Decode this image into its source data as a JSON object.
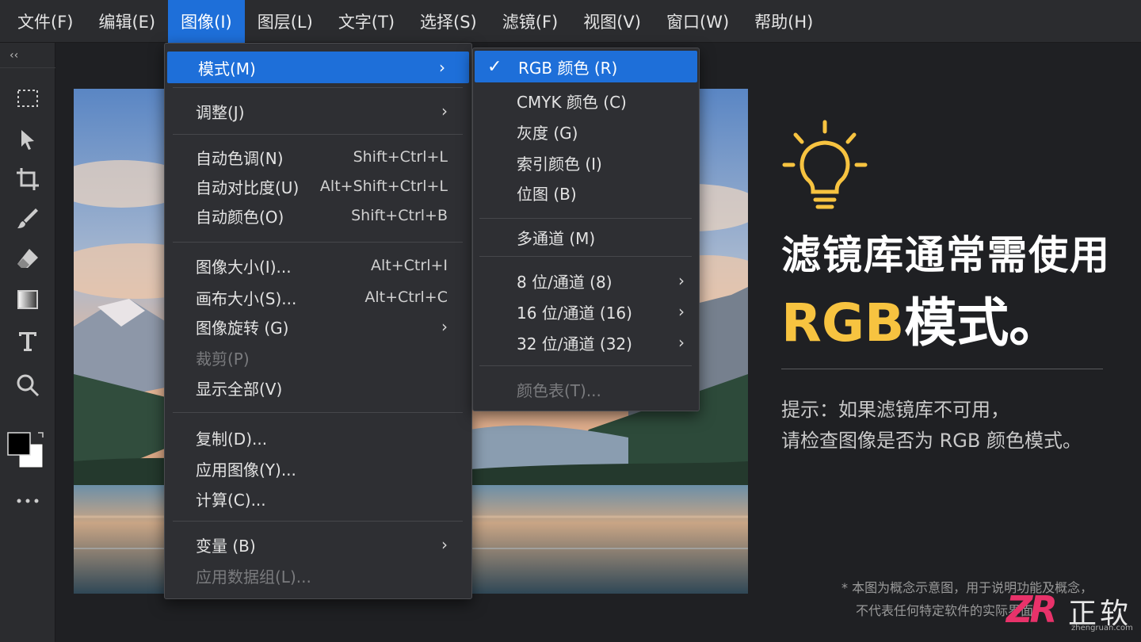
{
  "menubar": {
    "items": [
      "文件(F)",
      "编辑(E)",
      "图像(I)",
      "图层(L)",
      "文字(T)",
      "选择(S)",
      "滤镜(F)",
      "视图(V)",
      "窗口(W)",
      "帮助(H)"
    ],
    "active_index": 2
  },
  "toolbar": {
    "collapse": "‹‹",
    "tools": [
      "marquee-icon",
      "move-icon",
      "crop-icon",
      "brush-icon",
      "eraser-icon",
      "gradient-icon",
      "type-icon",
      "zoom-icon",
      "color-swatch-icon",
      "more-icon"
    ]
  },
  "image_menu": {
    "items": [
      {
        "label": "模式(M)",
        "shortcut": "",
        "submenu": true,
        "highlight": true
      },
      {
        "label": "调整(J)",
        "shortcut": "",
        "submenu": true
      },
      {
        "label": "自动色调(N)",
        "shortcut": "Shift+Ctrl+L"
      },
      {
        "label": "自动对比度(U)",
        "shortcut": "Alt+Shift+Ctrl+L"
      },
      {
        "label": "自动颜色(O)",
        "shortcut": "Shift+Ctrl+B"
      },
      {
        "label": "图像大小(I)...",
        "shortcut": "Alt+Ctrl+I"
      },
      {
        "label": "画布大小(S)...",
        "shortcut": "Alt+Ctrl+C"
      },
      {
        "label": "图像旋转 (G)",
        "shortcut": "",
        "submenu": true
      },
      {
        "label": "裁剪(P)",
        "shortcut": "",
        "disabled": true
      },
      {
        "label": "显示全部(V)",
        "shortcut": ""
      },
      {
        "label": "复制(D)...",
        "shortcut": ""
      },
      {
        "label": "应用图像(Y)...",
        "shortcut": ""
      },
      {
        "label": "计算(C)...",
        "shortcut": ""
      },
      {
        "label": "变量 (B)",
        "shortcut": "",
        "submenu": true
      },
      {
        "label": "应用数据组(L)...",
        "shortcut": "",
        "disabled": true
      }
    ]
  },
  "mode_menu": {
    "items": [
      {
        "label": "RGB 颜色 (R)",
        "checked": true,
        "highlight": true
      },
      {
        "label": "CMYK 颜色 (C)"
      },
      {
        "label": "灰度 (G)"
      },
      {
        "label": "索引颜色 (I)"
      },
      {
        "label": "位图 (B)"
      },
      {
        "label": "多通道 (M)"
      },
      {
        "label": "8 位/通道 (8)",
        "submenu": true
      },
      {
        "label": "16 位/通道 (16)",
        "submenu": true
      },
      {
        "label": "32 位/通道 (32)",
        "submenu": true
      },
      {
        "label": "颜色表(T)...",
        "disabled": true
      }
    ],
    "check_glyph": "✓",
    "arrow_glyph": "›"
  },
  "info": {
    "headline_line1": "滤镜库通常需使用",
    "headline_rgb": "RGB",
    "headline_rest": "模式。",
    "tip_line1": "提示：如果滤镜库不可用，",
    "tip_line2": "请检查图像是否为 RGB 颜色模式。",
    "disclaimer_line1": "* 本图为概念示意图，用于说明功能及概念，",
    "disclaimer_line2": "不代表任何特定软件的实际界面",
    "icon": "lightbulb-icon",
    "accent_color": "#f7c340"
  },
  "logo": {
    "mark": "ZR",
    "name": "正软",
    "url": "zhengruan.com"
  },
  "colors": {
    "menu_highlight": "#1e6fd9",
    "background": "#1f2023",
    "panel": "#2b2c2f"
  }
}
